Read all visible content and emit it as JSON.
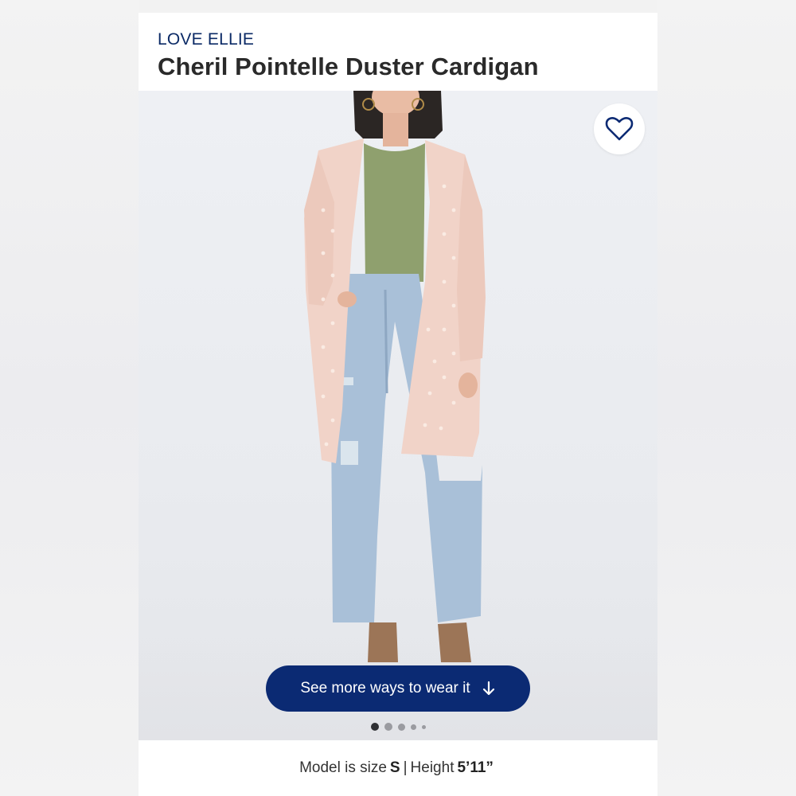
{
  "product": {
    "brand": "LOVE ELLIE",
    "title": "Cheril Pointelle Duster Cardigan"
  },
  "gallery": {
    "image_alt": "Model wearing cardigan, olive tank and distressed jeans",
    "favorite_icon": "heart-outline-icon",
    "cta_label": "See more ways to wear it",
    "cta_icon": "arrow-down-icon",
    "dots": [
      {
        "active": true
      },
      {
        "active": false
      },
      {
        "active": false
      },
      {
        "active": false
      },
      {
        "active": false
      }
    ]
  },
  "model_info": {
    "prefix": "Model is size",
    "size": "S",
    "separator": "|",
    "height_label": "Height",
    "height": "5’11”"
  },
  "colors": {
    "brand_navy": "#0b2a73",
    "cardigan": "#f1d3c8",
    "tank": "#8fa06e",
    "denim": "#a9c0d8",
    "boots": "#9c7557"
  }
}
